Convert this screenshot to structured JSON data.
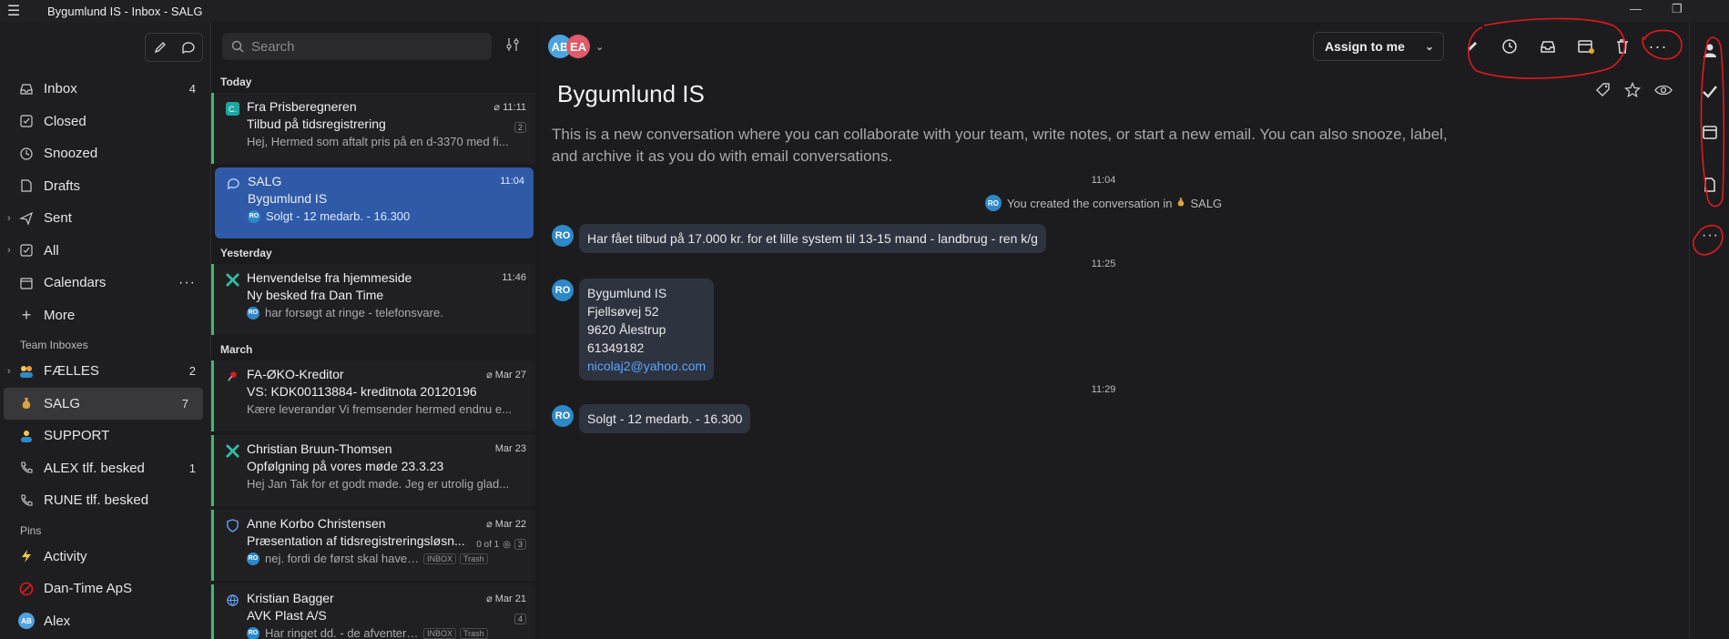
{
  "window": {
    "title": "Bygumlund IS - Inbox - SALG"
  },
  "nav": {
    "items": [
      {
        "label": "Inbox",
        "count": "4",
        "icon": "inbox-icon"
      },
      {
        "label": "Closed",
        "count": "",
        "icon": "check-square-icon"
      },
      {
        "label": "Snoozed",
        "count": "",
        "icon": "clock-icon"
      },
      {
        "label": "Drafts",
        "count": "",
        "icon": "draft-icon"
      },
      {
        "label": "Sent",
        "count": "",
        "icon": "send-icon"
      },
      {
        "label": "All",
        "count": "",
        "icon": "check-square-icon"
      },
      {
        "label": "Calendars",
        "count": "",
        "icon": "calendar-icon"
      },
      {
        "label": "More",
        "count": "",
        "icon": "plus-icon"
      }
    ],
    "team_section": "Team Inboxes",
    "team": [
      {
        "label": "FÆLLES",
        "count": "2"
      },
      {
        "label": "SALG",
        "count": "7"
      },
      {
        "label": "SUPPORT",
        "count": ""
      },
      {
        "label": "ALEX tlf. besked",
        "count": "1"
      },
      {
        "label": "RUNE tlf. besked",
        "count": ""
      }
    ],
    "pins_section": "Pins",
    "pins": [
      {
        "label": "Activity"
      },
      {
        "label": "Dan-Time ApS"
      },
      {
        "label": "Alex",
        "avatar": "AB"
      }
    ]
  },
  "search": {
    "placeholder": "Search"
  },
  "list": {
    "groups": {
      "today": "Today",
      "yesterday": "Yesterday",
      "march": "March"
    },
    "messages": [
      {
        "from": "Fra Prisberegneren",
        "time": "11:11",
        "subject": "Tilbud på tidsregistrering",
        "preview": "Hej, Hermed som aftalt pris på en d-3370 med fi...",
        "count": "2"
      },
      {
        "from": "SALG",
        "time": "11:04",
        "subject": "Bygumlund IS",
        "preview": "Solgt - 12 medarb. - 16.300",
        "avatar": "RO"
      },
      {
        "from": "Henvendelse fra hjemmeside",
        "time": "11:46",
        "subject": "Ny besked fra Dan Time",
        "preview": "har forsøgt at ringe - telefonsvare.",
        "avatar": "RO"
      },
      {
        "from": "FA-ØKO-Kreditor",
        "time": "Mar 27",
        "subject": "VS: KDK00113884- kreditnota 20120196",
        "preview": "Kære leverandør Vi fremsender hermed endnu e..."
      },
      {
        "from": "Christian Bruun-Thomsen",
        "time": "Mar 23",
        "subject": "Opfølgning på vores møde 23.3.23",
        "preview": "Hej Jan Tak for et godt møde. Jeg er utrolig glad..."
      },
      {
        "from": "Anne Korbo Christensen",
        "time": "Mar 22",
        "subject": "Præsentation af tidsregistreringsløsn...",
        "preview": "nej. fordi de først skal have m...",
        "progress": "0 of 1",
        "count": "3",
        "tags": [
          "INBOX",
          "Trash"
        ],
        "avatar": "RO"
      },
      {
        "from": "Kristian Bagger",
        "time": "Mar 21",
        "subject": "AVK Plast A/S",
        "preview": "Har ringet dd. - de afventer a...",
        "count": "4",
        "tags": [
          "INBOX",
          "Trash"
        ],
        "avatar": "RO"
      }
    ]
  },
  "conversation": {
    "avatars": [
      "AB",
      "EA"
    ],
    "assign_label": "Assign to me",
    "title": "Bygumlund IS",
    "description": "This is a new conversation where you can collaborate with your team, write notes, or start a new email. You can also snooze, label, and archive it as you do with email conversations.",
    "timeline": {
      "t1": "11:04",
      "system_prefix": "You created the conversation in",
      "system_team": "SALG",
      "msg1": "Har fået tilbud på 17.000 kr. for et lille system til 13-15 mand - landbrug - ren k/g",
      "t2": "11:25",
      "address": {
        "l1": "Bygumlund IS",
        "l2": "Fjellsøvej 52",
        "l3": "9620 Ålestrup",
        "l4": "61349182",
        "email": "nicolaj2@yahoo.com"
      },
      "t3": "11:29",
      "msg3": "Solgt - 12 medarb. - 16.300",
      "avatar": "RO"
    }
  },
  "colors": {
    "accent": "#2d89c8",
    "selected": "#2e5aa8",
    "unread_bar": "#3fb871",
    "annotation": "#e0191e"
  }
}
